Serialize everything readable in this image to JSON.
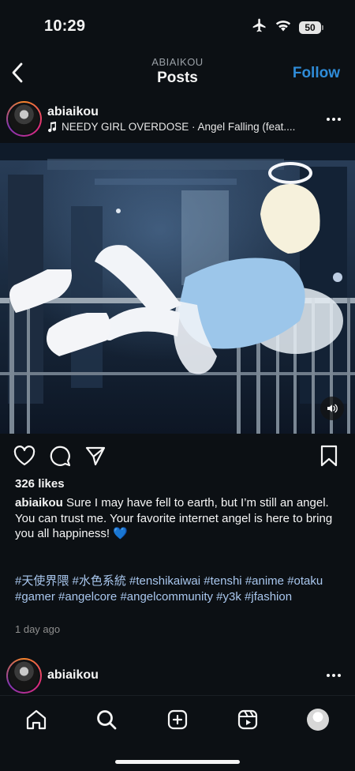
{
  "status_bar": {
    "time": "10:29",
    "battery": "50"
  },
  "header": {
    "username": "ABIAIKOU",
    "title": "Posts",
    "follow_label": "Follow"
  },
  "post": {
    "username": "abiaikou",
    "audio": "NEEDY GIRL OVERDOSE · Angel Falling (feat....",
    "likes": "326 likes",
    "caption_user": "abiaikou",
    "caption_line1": "Sure I may have fell to earth, but I’m still an angel.",
    "caption_line2": "You can trust me. Your favorite internet angel is here to bring you all happiness! 💙",
    "hashtags": [
      "#天使界隈",
      "#水色系統",
      "#tenshikaiwai",
      "#tenshi",
      "#anime",
      "#otaku",
      "#gamer",
      "#angelcore",
      "#angelcommunity",
      "#y3k",
      "#jfashion"
    ],
    "time_ago": "1 day ago"
  },
  "next_post": {
    "username": "abiaikou"
  },
  "icons": {
    "airplane": "airplane-icon",
    "wifi": "wifi-icon",
    "back": "chevron-left-icon",
    "music": "music-note-icon",
    "more": "more-horizontal-icon",
    "sound": "speaker-icon",
    "like": "heart-icon",
    "comment": "comment-icon",
    "share": "send-icon",
    "save": "bookmark-icon",
    "home": "home-icon",
    "search": "search-icon",
    "create": "plus-square-icon",
    "reels": "reels-icon"
  },
  "colors": {
    "background": "#0c1014",
    "accent": "#2f8cd8",
    "hashtag": "#a9c7ee",
    "muted": "#8e8e8e"
  }
}
